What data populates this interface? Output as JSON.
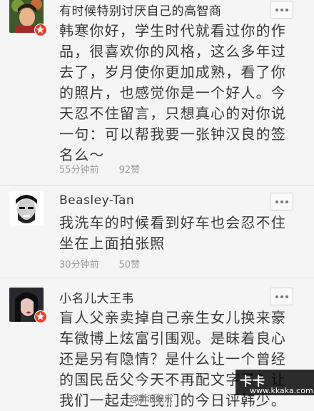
{
  "comments": [
    {
      "username": "有时候特别讨厌自己的高智商",
      "lines": [
        "韩寒你好，学生时代就看过你的作",
        "品，很喜欢你的风格，这么多年过",
        "去了，岁月使你更加成熟，看了你",
        "的照片，也感觉你是一个好人。今",
        "天忍不住留言，只想真心的对你说",
        "一句：可以帮我要一张钟汉良的签",
        "名么～"
      ],
      "time": "55分钟前",
      "likes": "92赞"
    },
    {
      "username": "Beasley-Tan",
      "lines": [
        "我洗车的时候看到好车也会忍不住",
        "坐在上面拍张照"
      ],
      "time": "30分钟前",
      "likes": "50赞"
    },
    {
      "username": "小名儿大王韦",
      "lines": [
        "盲人父亲卖掉自己亲生女儿换来豪",
        "车微博上炫富引围观。是昧着良心",
        "还是另有隐情？是什么让一个曾经",
        "的国民岳父今天不再配文字了？让",
        "我们一起走进我们的今日评韩少。"
      ],
      "time": "",
      "likes": ""
    }
  ],
  "watermark": {
    "logo": "卡卡",
    "url": "www.kkaka.com",
    "source": "@新浪娱乐"
  },
  "colors": {
    "badge": "#e8402b",
    "text": "#3a3a3a",
    "meta": "#9b9b9b",
    "background": "#f5f5f5"
  }
}
